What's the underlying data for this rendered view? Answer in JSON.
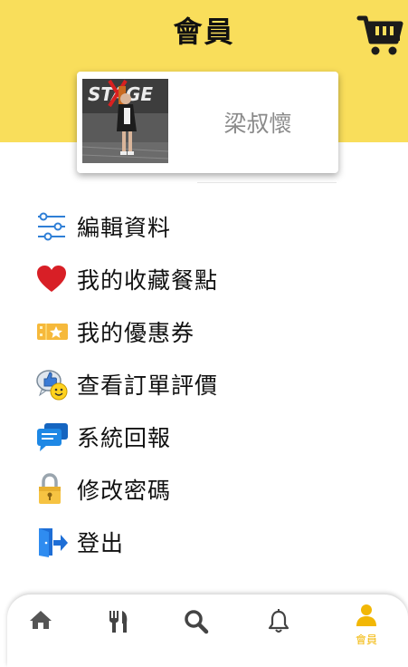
{
  "header": {
    "title": "會員",
    "accent_color": "#f9de5b",
    "cart_icon": "shopping-cart-icon"
  },
  "profile": {
    "name": "梁叔懷",
    "avatar_icon": "user-photo"
  },
  "menu": {
    "items": [
      {
        "label": "編輯資料",
        "icon": "sliders-icon"
      },
      {
        "label": "我的收藏餐點",
        "icon": "heart-icon"
      },
      {
        "label": "我的優惠券",
        "icon": "ticket-icon"
      },
      {
        "label": "查看訂單評價",
        "icon": "thumbs-up-smiley-icon"
      },
      {
        "label": "系統回報",
        "icon": "chat-bubble-icon"
      },
      {
        "label": "修改密碼",
        "icon": "padlock-icon"
      },
      {
        "label": "登出",
        "icon": "logout-door-icon"
      }
    ]
  },
  "bottom_nav": {
    "active_color": "#f2b705",
    "items": [
      {
        "icon": "home-icon"
      },
      {
        "icon": "fork-knife-icon"
      },
      {
        "icon": "search-icon"
      },
      {
        "icon": "bell-icon"
      },
      {
        "icon": "member-icon",
        "label": "會員",
        "active": true
      }
    ]
  }
}
